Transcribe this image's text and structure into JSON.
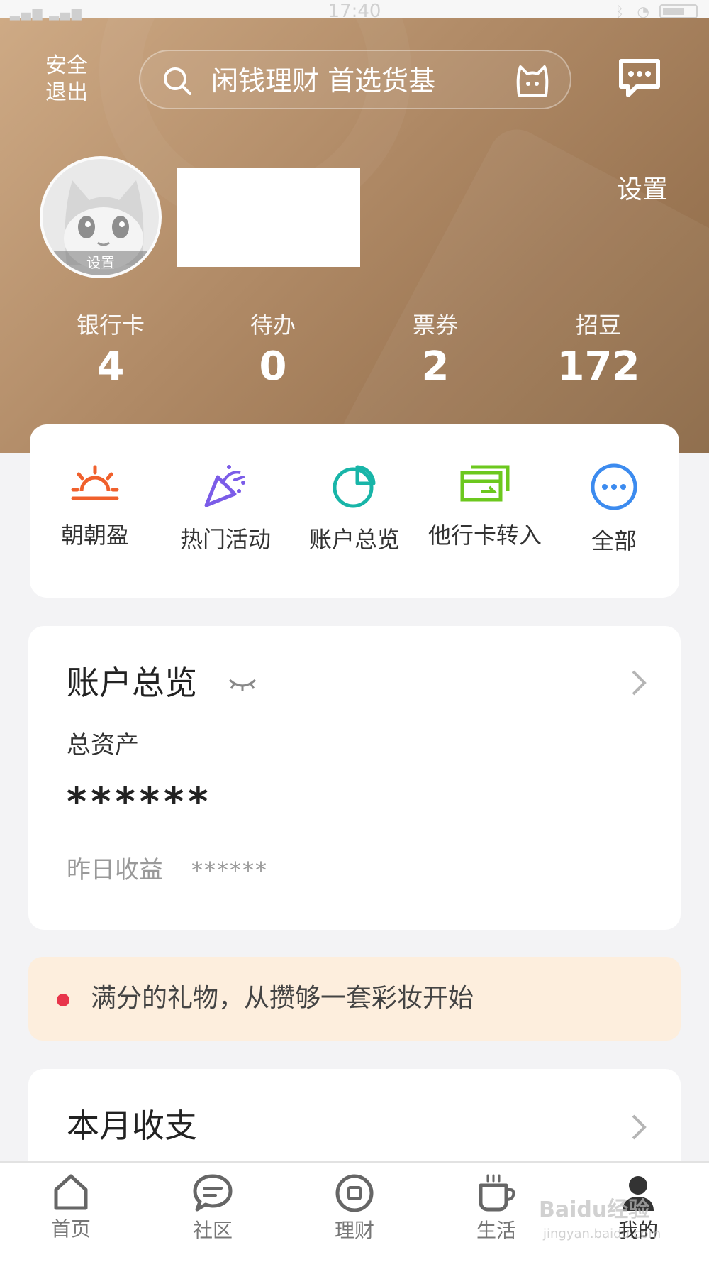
{
  "status_bar": {
    "time": "17:40"
  },
  "header": {
    "logout_label": "安全\n退出",
    "search_placeholder": "闲钱理财 首选货基",
    "settings_label": "设置",
    "avatar_badge": "设置"
  },
  "stats": [
    {
      "label": "银行卡",
      "value": "4"
    },
    {
      "label": "待办",
      "value": "0"
    },
    {
      "label": "票券",
      "value": "2"
    },
    {
      "label": "招豆",
      "value": "172"
    }
  ],
  "shortcuts": [
    {
      "label": "朝朝盈",
      "icon": "sunrise-icon",
      "color": "#f0602c"
    },
    {
      "label": "热门活动",
      "icon": "party-popper-icon",
      "color": "#7b5ce8"
    },
    {
      "label": "账户总览",
      "icon": "pie-chart-icon",
      "color": "#18b5a8"
    },
    {
      "label": "他行卡转入",
      "icon": "card-transfer-icon",
      "color": "#6cc81e"
    },
    {
      "label": "全部",
      "icon": "more-icon",
      "color": "#3c8bef"
    }
  ],
  "overview": {
    "title": "账户总览",
    "total_assets_label": "总资产",
    "total_assets_value": "******",
    "yesterday_label": "昨日收益",
    "yesterday_value": "******"
  },
  "banner": {
    "text": "满分的礼物，从攒够一套彩妆开始",
    "dot_color": "#e8344a"
  },
  "monthly": {
    "title": "本月收支"
  },
  "tabbar": [
    {
      "label": "首页",
      "icon": "home-icon"
    },
    {
      "label": "社区",
      "icon": "chat-bubble-icon"
    },
    {
      "label": "理财",
      "icon": "wealth-coin-icon"
    },
    {
      "label": "生活",
      "icon": "coffee-cup-icon"
    },
    {
      "label": "我的",
      "icon": "user-icon",
      "active": true
    }
  ],
  "watermark": {
    "brand": "Baidu经验",
    "url": "jingyan.baidu.com"
  },
  "colors": {
    "hero_start": "#cfab86",
    "hero_end": "#8b6845",
    "accent_red": "#e8344a"
  }
}
